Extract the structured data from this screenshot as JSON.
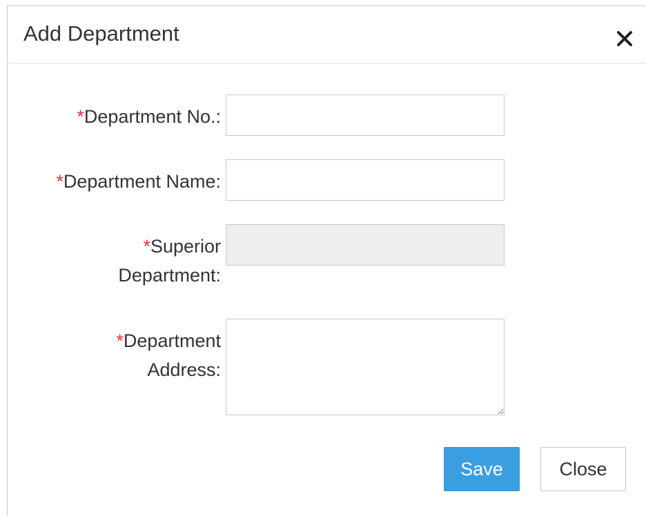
{
  "dialog": {
    "title": "Add Department"
  },
  "form": {
    "required_mark": "*",
    "department_no": {
      "label": "Department No.:",
      "value": ""
    },
    "department_name": {
      "label": "Department Name:",
      "value": ""
    },
    "superior_department": {
      "label_line1": "Superior",
      "label_line2": "Department:",
      "value": ""
    },
    "department_address": {
      "label_line1": "Department",
      "label_line2": "Address:",
      "value": ""
    }
  },
  "buttons": {
    "save": "Save",
    "close": "Close"
  },
  "icons": {
    "close": "close-icon"
  },
  "colors": {
    "accent": "#3a9ee0",
    "required": "#e5313a",
    "header_divider": "#cfe3f3"
  }
}
